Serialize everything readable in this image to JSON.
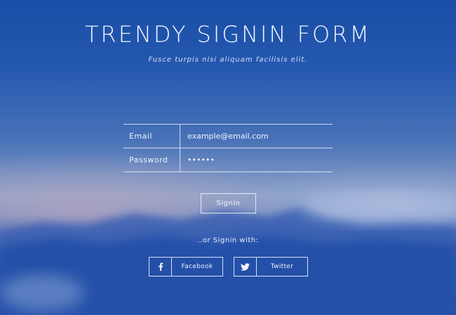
{
  "page": {
    "title": "TRENDY SIGNIN FORM",
    "subtitle": "Fusce turpis nisi aliquam facilisis elit."
  },
  "form": {
    "email_label": "Email",
    "email_value": "example@email.com",
    "password_label": "Password",
    "password_value": "••••••",
    "signin_label": "Signin"
  },
  "social": {
    "or_text": "..or Signin with:",
    "facebook_label": "Facebook",
    "facebook_icon": "facebook-icon",
    "twitter_label": "Twitter",
    "twitter_icon": "twitter-icon"
  }
}
